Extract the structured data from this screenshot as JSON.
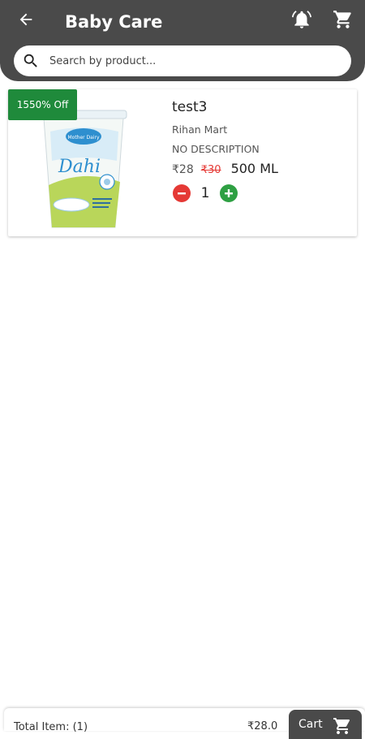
{
  "header": {
    "title": "Baby Care",
    "back_icon": "arrow-left-icon",
    "notification_icon": "bell-icon",
    "cart_icon": "cart-icon",
    "background": "#4a4a4a"
  },
  "search": {
    "placeholder": "Search by product...",
    "value": "",
    "icon": "search-icon"
  },
  "products": [
    {
      "discount_label": "1550% Off",
      "name": "test3",
      "store": "Rihan Mart",
      "description": "NO DESCRIPTION",
      "price": "₹28",
      "mrp": "₹30",
      "unit": "500 ML",
      "quantity": "1",
      "image_brand": "Mother Dairy",
      "image_name": "Dahi",
      "badge_color": "#1f8a3b",
      "minus_color": "#e53935",
      "plus_color": "#2ea043"
    }
  ],
  "bottom_bar": {
    "total_items_label": "Total Item: (1)",
    "total_price": "₹28.0",
    "cart_button_label": "Cart",
    "cart_icon": "cart-icon"
  }
}
